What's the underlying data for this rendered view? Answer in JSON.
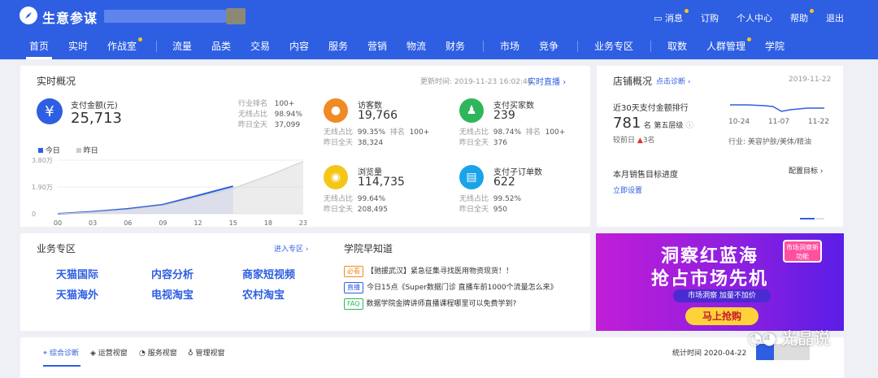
{
  "app": {
    "name": "生意参谋"
  },
  "top_links": [
    {
      "label": "消息",
      "icon": "message-icon",
      "dot": true
    },
    {
      "label": "订购",
      "dot": false
    },
    {
      "label": "个人中心",
      "dot": false
    },
    {
      "label": "帮助",
      "dot": true
    },
    {
      "label": "退出",
      "dot": false
    }
  ],
  "nav": [
    {
      "label": "首页",
      "active": true,
      "dot": false
    },
    {
      "label": "实时",
      "active": false,
      "dot": false
    },
    {
      "label": "作战室",
      "active": false,
      "dot": true
    },
    {
      "label": "流量",
      "active": false,
      "dot": false
    },
    {
      "label": "品类",
      "active": false,
      "dot": false
    },
    {
      "label": "交易",
      "active": false,
      "dot": false
    },
    {
      "label": "内容",
      "active": false,
      "dot": false
    },
    {
      "label": "服务",
      "active": false,
      "dot": false
    },
    {
      "label": "营销",
      "active": false,
      "dot": false
    },
    {
      "label": "物流",
      "active": false,
      "dot": false
    },
    {
      "label": "财务",
      "active": false,
      "dot": false
    },
    {
      "label": "市场",
      "active": false,
      "dot": false
    },
    {
      "label": "竞争",
      "active": false,
      "dot": false
    },
    {
      "label": "业务专区",
      "active": false,
      "dot": false
    },
    {
      "label": "取数",
      "active": false,
      "dot": false
    },
    {
      "label": "人群管理",
      "active": false,
      "dot": true
    },
    {
      "label": "学院",
      "active": false,
      "dot": false
    }
  ],
  "realtime": {
    "title": "实时概况",
    "update_time": "更新时间: 2019-11-23 16:02:46",
    "live_link": "实时直播",
    "payment": {
      "label": "支付金额(元)",
      "value": "25,713",
      "stats": [
        {
          "k": "行业排名",
          "v": "100+"
        },
        {
          "k": "无线占比",
          "v": "98.94%"
        },
        {
          "k": "昨日全天",
          "v": "37,099"
        }
      ]
    },
    "legend_today": "今日",
    "legend_yesterday": "昨日",
    "y_ticks": [
      "3.80万",
      "1.90万",
      "0"
    ],
    "x_ticks": [
      "00",
      "03",
      "06",
      "09",
      "12",
      "15",
      "18",
      "23"
    ],
    "metrics": [
      {
        "icon": "footprint-icon",
        "color": "#f08a24",
        "label": "访客数",
        "value": "19,766",
        "stats": [
          {
            "k": "无线占比",
            "v": "99.35%"
          },
          {
            "k": "排名",
            "v": "100+"
          },
          {
            "k": "昨日全天",
            "v": "38,324"
          }
        ]
      },
      {
        "icon": "buyer-icon",
        "color": "#2fb65a",
        "label": "支付买家数",
        "value": "239",
        "stats": [
          {
            "k": "无线占比",
            "v": "98.74%"
          },
          {
            "k": "排名",
            "v": "100+"
          },
          {
            "k": "昨日全天",
            "v": "376"
          }
        ]
      },
      {
        "icon": "eye-icon",
        "color": "#f5c518",
        "label": "浏览量",
        "value": "114,735",
        "stats": [
          {
            "k": "无线占比",
            "v": "99.64%"
          },
          {
            "k": "",
            "v": ""
          },
          {
            "k": "昨日全天",
            "v": "208,495"
          }
        ]
      },
      {
        "icon": "order-icon",
        "color": "#1aa3e8",
        "label": "支付子订单数",
        "value": "622",
        "stats": [
          {
            "k": "无线占比",
            "v": "99.52%"
          },
          {
            "k": "",
            "v": ""
          },
          {
            "k": "昨日全天",
            "v": "950"
          }
        ]
      }
    ]
  },
  "chart_data": {
    "type": "area",
    "x": [
      "00",
      "03",
      "06",
      "09",
      "12",
      "15",
      "18",
      "23"
    ],
    "ylim": [
      0,
      38000
    ],
    "series": [
      {
        "name": "今日",
        "values": [
          0,
          1500,
          3500,
          6500,
          13000,
          19500,
          null,
          null
        ]
      },
      {
        "name": "昨日",
        "values": [
          0,
          1200,
          3000,
          6000,
          12000,
          18000,
          27000,
          37099
        ]
      }
    ]
  },
  "store": {
    "title": "店铺概况",
    "diag_link": "点击诊断",
    "date": "2019-11-22",
    "rank_label": "近30天支付金额排行",
    "rank_value": "781",
    "rank_unit": "名",
    "tier": "第五层级",
    "prev_label": "较前日",
    "prev_change": "3名",
    "spark_x": [
      "10-24",
      "11-07",
      "11-22"
    ],
    "industry": "行业: 美容护肤/美体/精油",
    "target_label": "本月销售目标进度",
    "target_link": "配置目标",
    "setup_link": "立即设置"
  },
  "business": {
    "title": "业务专区",
    "enter": "进入专区",
    "links": [
      "天猫国际",
      "内容分析",
      "商家短视频",
      "天猫海外",
      "电视淘宝",
      "农村淘宝"
    ]
  },
  "academy": {
    "title": "学院早知道",
    "items": [
      {
        "tag": "必看",
        "tag_color": "#f08a24",
        "text": "【驰援武汉】紧急征集寻找医用物资现货！！"
      },
      {
        "tag": "直播",
        "tag_color": "#2e5fe2",
        "text": "今日15点《Super数据门诊 直播车前1000个流量怎么来》"
      },
      {
        "tag": "FAQ",
        "tag_color": "#2fb65a",
        "text": "数据学院金牌讲师直播课程哪里可以免费学到?"
      }
    ]
  },
  "promo": {
    "line1": "洞察红蓝海",
    "line2": "抢占市场先机",
    "tag": "市场洞察新功能",
    "pill": "市场洞察 加量不加价",
    "button": "马上抢购"
  },
  "bottom": {
    "tabs": [
      {
        "label": "综合诊断",
        "icon": "pin-icon",
        "active": true
      },
      {
        "label": "运营视窗",
        "icon": "shield-icon",
        "active": false
      },
      {
        "label": "服务视窗",
        "icon": "headset-icon",
        "active": false
      },
      {
        "label": "管理视窗",
        "icon": "medal-icon",
        "active": false
      }
    ],
    "stat_time": "统计时间 2020-04-22"
  },
  "watermark": "光晶说",
  "colors": {
    "brand": "#2e5fe2",
    "today": "#2e5fe2",
    "yesterday": "#cccccc"
  }
}
